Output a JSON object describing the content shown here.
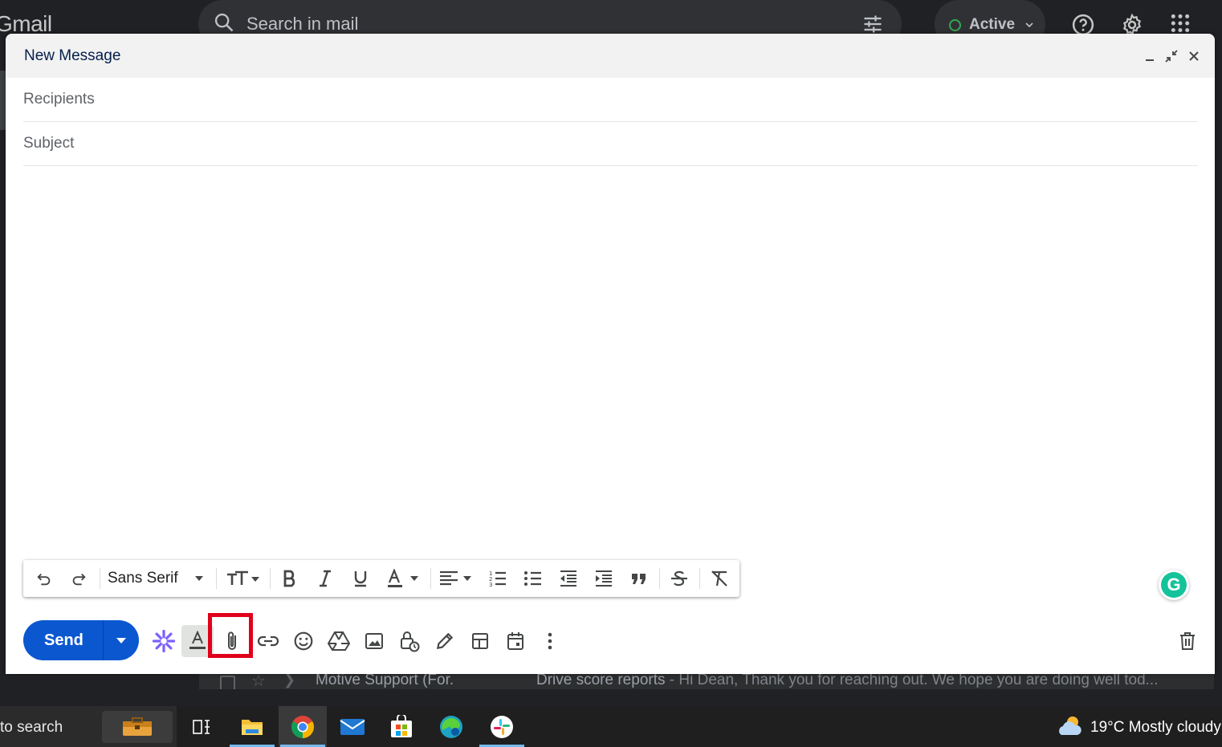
{
  "gmail": {
    "logo_text": "Gmail",
    "search_placeholder": "Search in mail",
    "status_label": "Active"
  },
  "compose": {
    "title": "New Message",
    "recipients_placeholder": "Recipients",
    "subject_placeholder": "Subject",
    "font_name": "Sans Serif",
    "send_label": "Send",
    "grammarly_letter": "G"
  },
  "background_row": {
    "sender": "Motive Support (For.",
    "subject": "Drive score reports",
    "snippet": " - Hi Dean, Thank you for reaching out. We hope you are doing well tod..."
  },
  "taskbar": {
    "search_text": "to search",
    "weather": "19°C  Mostly cloudy"
  },
  "colors": {
    "send_blue": "#0b57d0",
    "highlight_red": "#e0001a",
    "title_navy": "#041e49"
  }
}
